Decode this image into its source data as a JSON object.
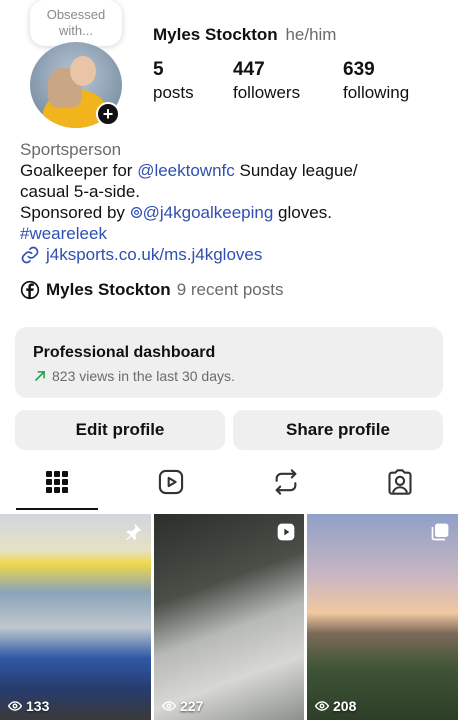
{
  "note": {
    "text": "Obsessed with..."
  },
  "profile": {
    "name": "Myles Stockton",
    "pronouns": "he/him"
  },
  "stats": [
    {
      "value": "5",
      "label": "posts"
    },
    {
      "value": "447",
      "label": "followers"
    },
    {
      "value": "639",
      "label": "following"
    }
  ],
  "bio": {
    "category": "Sportsperson",
    "line1_pre": "Goalkeeper for ",
    "line1_mention": "@leektownfc",
    "line1_post": " Sunday league/",
    "line2": "casual 5-a-side.",
    "line3_pre": "Sponsored by ",
    "line3_mention": "@j4kgoalkeeping",
    "line3_post": " gloves.",
    "hashtag": "#weareleek",
    "link": "j4ksports.co.uk/ms.j4kgloves"
  },
  "facebook": {
    "name": "Myles Stockton",
    "count_text": "9 recent posts"
  },
  "dashboard": {
    "title": "Professional dashboard",
    "subtitle": "823 views in the last 30 days."
  },
  "buttons": {
    "edit": "Edit profile",
    "share": "Share profile"
  },
  "tabs": [
    "grid-icon",
    "reels-icon",
    "reposts-icon",
    "tagged-icon"
  ],
  "posts": [
    {
      "views": "133",
      "badge": "pin-icon"
    },
    {
      "views": "227",
      "badge": "reel-icon"
    },
    {
      "views": "208",
      "badge": "carousel-icon"
    }
  ],
  "colors": {
    "link": "#2f4fb3",
    "button_bg": "#efefef",
    "secondary_text": "#6b6b6b",
    "growth_arrow": "#1a9d4a"
  }
}
